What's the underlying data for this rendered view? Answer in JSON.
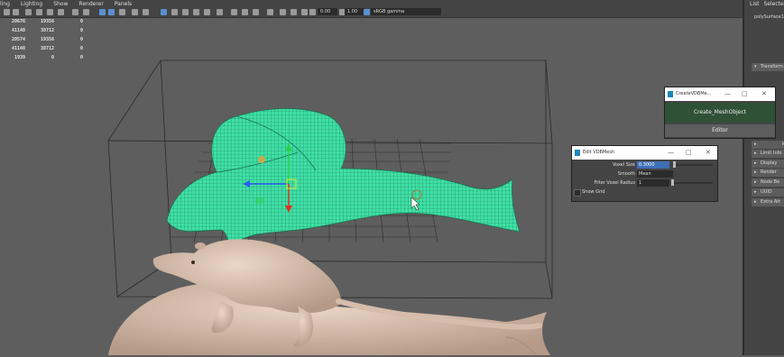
{
  "menu": [
    "ling",
    "Lighting",
    "Show",
    "Renderer",
    "Panels"
  ],
  "toolbar": {
    "exposure": "0.00",
    "gamma": "1.00",
    "colorspace": "sRGB gamma"
  },
  "hud": {
    "rows": [
      [
        "20676",
        "19356",
        "0"
      ],
      [
        "41148",
        "38712",
        "0"
      ],
      [
        "20574",
        "19356",
        "0"
      ],
      [
        "41148",
        "38712",
        "0"
      ],
      [
        "1939",
        "0",
        "0"
      ]
    ]
  },
  "right_panel": {
    "tabs": [
      "List",
      "Selected"
    ],
    "object": "polySurface1",
    "sections": [
      "Transform",
      "k",
      "Limit Info",
      "Display",
      "Render",
      "Node Be",
      "UUID",
      "Extra Att"
    ]
  },
  "create_window": {
    "title": "CreateVDBMe...",
    "create_button": "Create_MeshObject",
    "editor_button": "Editor"
  },
  "edit_window": {
    "title": "Edit VDBMesh",
    "voxel_size_label": "Voxel Size",
    "voxel_size_value": "0.3000",
    "smooth_label": "Smooth",
    "smooth_value": "Mean",
    "filter_label": "Filter Voxel Radius",
    "filter_value": "1",
    "show_grid_label": "Show Grid"
  },
  "colors": {
    "viewport_bg": "#5e5e5e",
    "selected_mesh": "#3fe0a6",
    "model_skin": "#d9bfae",
    "panel_bg": "#444444",
    "accent_button": "#2f5136"
  }
}
